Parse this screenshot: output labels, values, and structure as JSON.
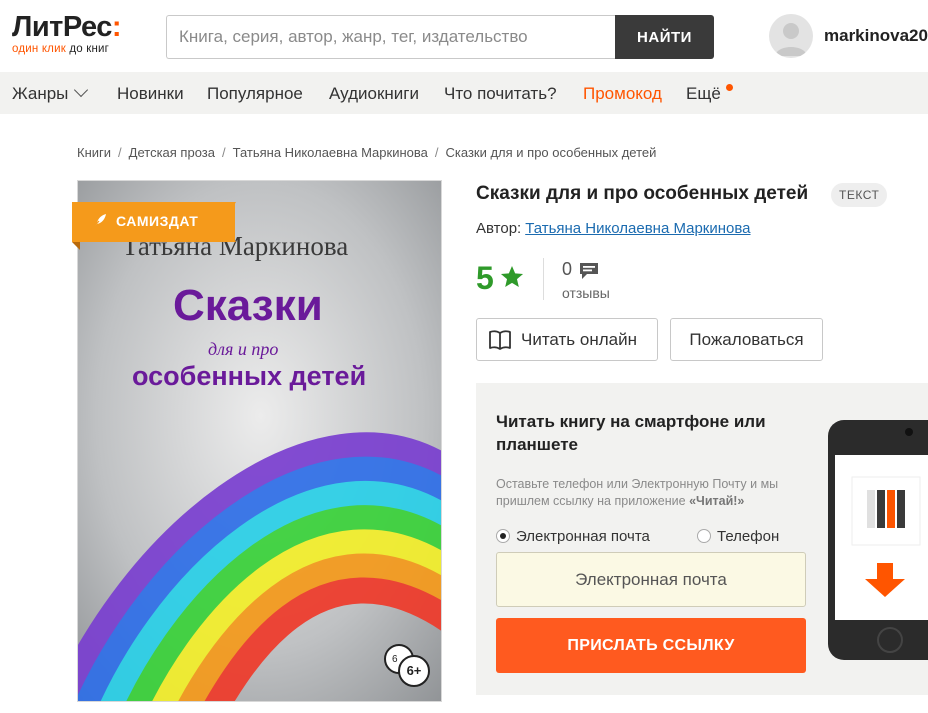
{
  "header": {
    "logo_main": "ЛитРес",
    "logo_colon": ":",
    "logo_sub_hl": "один клик",
    "logo_sub_rest": " до книг",
    "search_placeholder": "Книга, серия, автор, жанр, тег, издательство",
    "search_button": "НАЙТИ",
    "username": "markinova20"
  },
  "nav": {
    "items": [
      "Жанры",
      "Новинки",
      "Популярное",
      "Аудиокниги",
      "Что почитать?",
      "Промокод",
      "Ещё"
    ]
  },
  "breadcrumb": [
    "Книги",
    "Детская проза",
    "Татьяна Николаевна Маркинова",
    "Сказки для и про особенных детей"
  ],
  "breadcrumb_sep": "/",
  "cover": {
    "badge": "САМИЗДАТ",
    "author_text": "Татьяна Маркинова",
    "title_line1": "Сказки",
    "title_line2": "для и про",
    "title_line3": "особенных детей",
    "age": "6+",
    "age_behind": "6"
  },
  "book": {
    "title": "Сказки для и про особенных детей",
    "type": "ТЕКСТ",
    "author_label": "Автор:",
    "author": "Татьяна Николаевна Маркинова",
    "rating": "5",
    "reviews_count": "0",
    "reviews_label": "отзывы",
    "read_online": "Читать онлайн",
    "complain": "Пожаловаться"
  },
  "app_promo": {
    "title": "Читать книгу на смартфоне или планшете",
    "desc": "Оставьте телефон или Электронную Почту и мы пришлем ссылку на приложение",
    "desc_app": "«Читай!»",
    "option_email": "Электронная почта",
    "option_phone": "Телефон",
    "input_placeholder": "Электронная почта",
    "send_button": "ПРИСЛАТЬ ССЫЛКУ"
  },
  "colors": {
    "accent": "#ff5500",
    "rating_green": "#2f9a2a",
    "badge_orange": "#f59a1b",
    "link_blue": "#1b6bb0"
  }
}
